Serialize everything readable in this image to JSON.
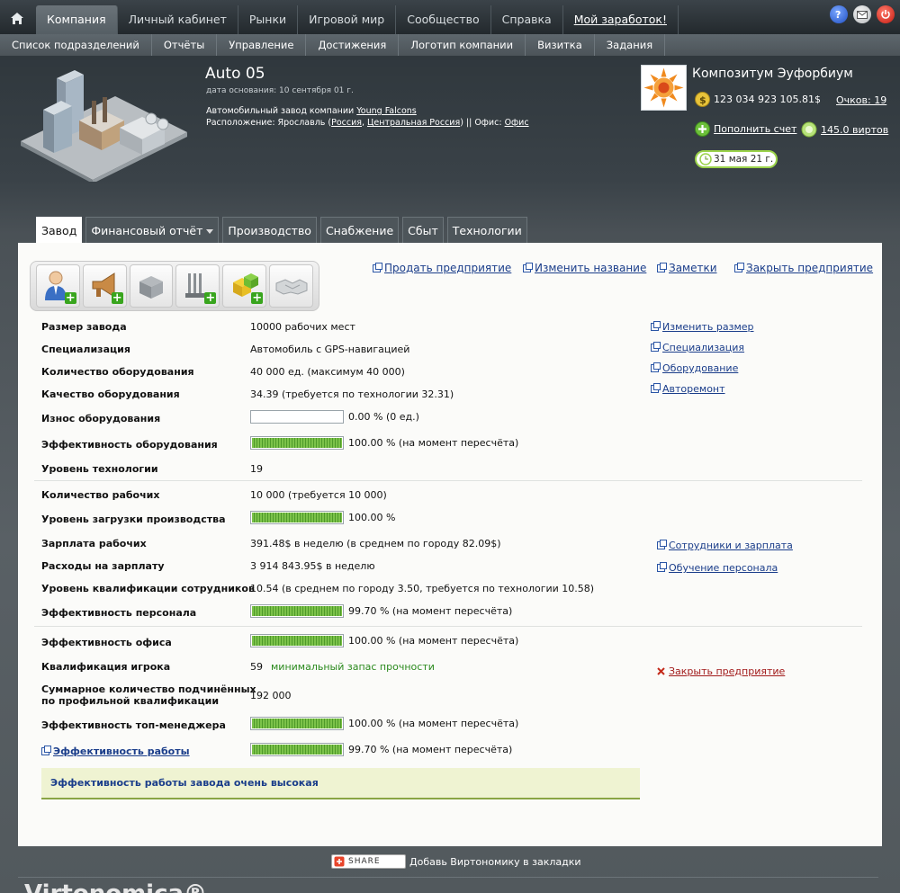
{
  "topnav": {
    "items": [
      {
        "label": "Компания",
        "active": true
      },
      {
        "label": "Личный кабинет"
      },
      {
        "label": "Рынки"
      },
      {
        "label": "Игровой мир"
      },
      {
        "label": "Сообщество"
      },
      {
        "label": "Справка"
      },
      {
        "label": "Мой заработок!"
      }
    ],
    "right_icons": [
      "help-icon",
      "mail-icon",
      "power-icon"
    ]
  },
  "subnav": {
    "items": [
      "Список подразделений",
      "Отчёты",
      "Управление",
      "Достижения",
      "Логотип компании",
      "Визитка",
      "Задания"
    ]
  },
  "unit": {
    "title": "Auto 05",
    "founded": "дата основания: 10 сентября 01 г.",
    "desc_prefix": "Автомобильный завод компании",
    "company_link": "Young Falcons",
    "location_prefix": "Расположение: Ярославль (",
    "country": "Россия",
    "comma": ",",
    "region": "Центральная Россия",
    "office_prefix": ") || Офис:",
    "office": "Офис"
  },
  "company": {
    "name": "Композитум Эуфорбиум",
    "money": "123 034 923 105.81$",
    "points": "Очков: 19",
    "topup": "Пополнить счет",
    "virts": "145.0 виртов",
    "date": "31 мая 21 г."
  },
  "tabs": [
    "Завод",
    "Финансовый отчёт",
    "Производство",
    "Снабжение",
    "Сбыт",
    "Технологии"
  ],
  "actions": {
    "sell": "Продать предприятие",
    "rename": "Изменить название",
    "notes": "Заметки",
    "close": "Закрыть предприятие"
  },
  "toolbar_icons": [
    "hire-manager-icon",
    "advertising-icon",
    "box-icon",
    "equipment-icon",
    "cubes-icon",
    "handshake-icon"
  ],
  "rows": {
    "size": {
      "label": "Размер завода",
      "value": "10000 рабочих мест"
    },
    "spec": {
      "label": "Специализация",
      "value": "Автомобиль с GPS-навигацией"
    },
    "eq_count": {
      "label": "Количество оборудования",
      "value": "40 000 ед. (максимум 40 000)"
    },
    "eq_quality": {
      "label": "Качество оборудования",
      "value": "34.39 (требуется по технологии 32.31)"
    },
    "wear": {
      "label": "Износ оборудования",
      "value": "0.00 % (0 ед.)",
      "fill": 0
    },
    "eq_eff": {
      "label": "Эффективность оборудования",
      "value": "100.00 % (на момент пересчёта)",
      "fill": 1.0
    },
    "tech": {
      "label": "Уровень технологии",
      "value": "19"
    },
    "workers": {
      "label": "Количество рабочих",
      "value": "10 000 (требуется 10 000)"
    },
    "load": {
      "label": "Уровень загрузки производства",
      "value": "100.00 %",
      "fill": 1.0
    },
    "salary": {
      "label": "Зарплата рабочих",
      "value": "391.48$ в неделю (в среднем по городу 82.09$)"
    },
    "salary_cost": {
      "label": "Расходы на зарплату",
      "value": "3 914 843.95$ в неделю"
    },
    "qual": {
      "label": "Уровень квалификации сотрудников",
      "value": "10.54 (в среднем по городу 3.50, требуется по технологии 10.58)"
    },
    "staff_eff": {
      "label": "Эффективность персонала",
      "value": "99.70 % (на момент пересчёта)",
      "fill": 0.997
    },
    "office_eff": {
      "label": "Эффективность офиса",
      "value": "100.00 % (на момент пересчёта)",
      "fill": 1.0
    },
    "player_qual": {
      "label": "Квалификация игрока",
      "value": "59",
      "note": "минимальный запас прочности"
    },
    "sub_qual_1": "Суммарное количество подчинённых",
    "sub_qual_2": "по профильной квалификации",
    "sub_qual_value": "192 000",
    "top_eff": {
      "label": "Эффективность топ-менеджера",
      "value": "100.00 % (на момент пересчёта)",
      "fill": 1.0
    },
    "work_eff": {
      "label": "Эффективность работы",
      "value": "99.70 % (на момент пересчёта)",
      "fill": 0.997
    }
  },
  "side_links": {
    "resize": "Изменить размер",
    "spec": "Специализация",
    "equipment": "Оборудование",
    "repair": "Авторемонт",
    "staff": "Сотрудники и зарплата",
    "training": "Обучение персонала",
    "close": "Закрыть предприятие"
  },
  "status": "Эффективность работы завода очень высокая",
  "footer": {
    "share": "SHARE",
    "bookmark": "Добавь Виртономику в закладки",
    "logo": "Virtonomica®"
  },
  "colors": {
    "accent_green": "#7cc24a",
    "link_blue": "#1a3d8a",
    "close_red": "#a21c1c",
    "status_bg": "#eff3d2"
  }
}
